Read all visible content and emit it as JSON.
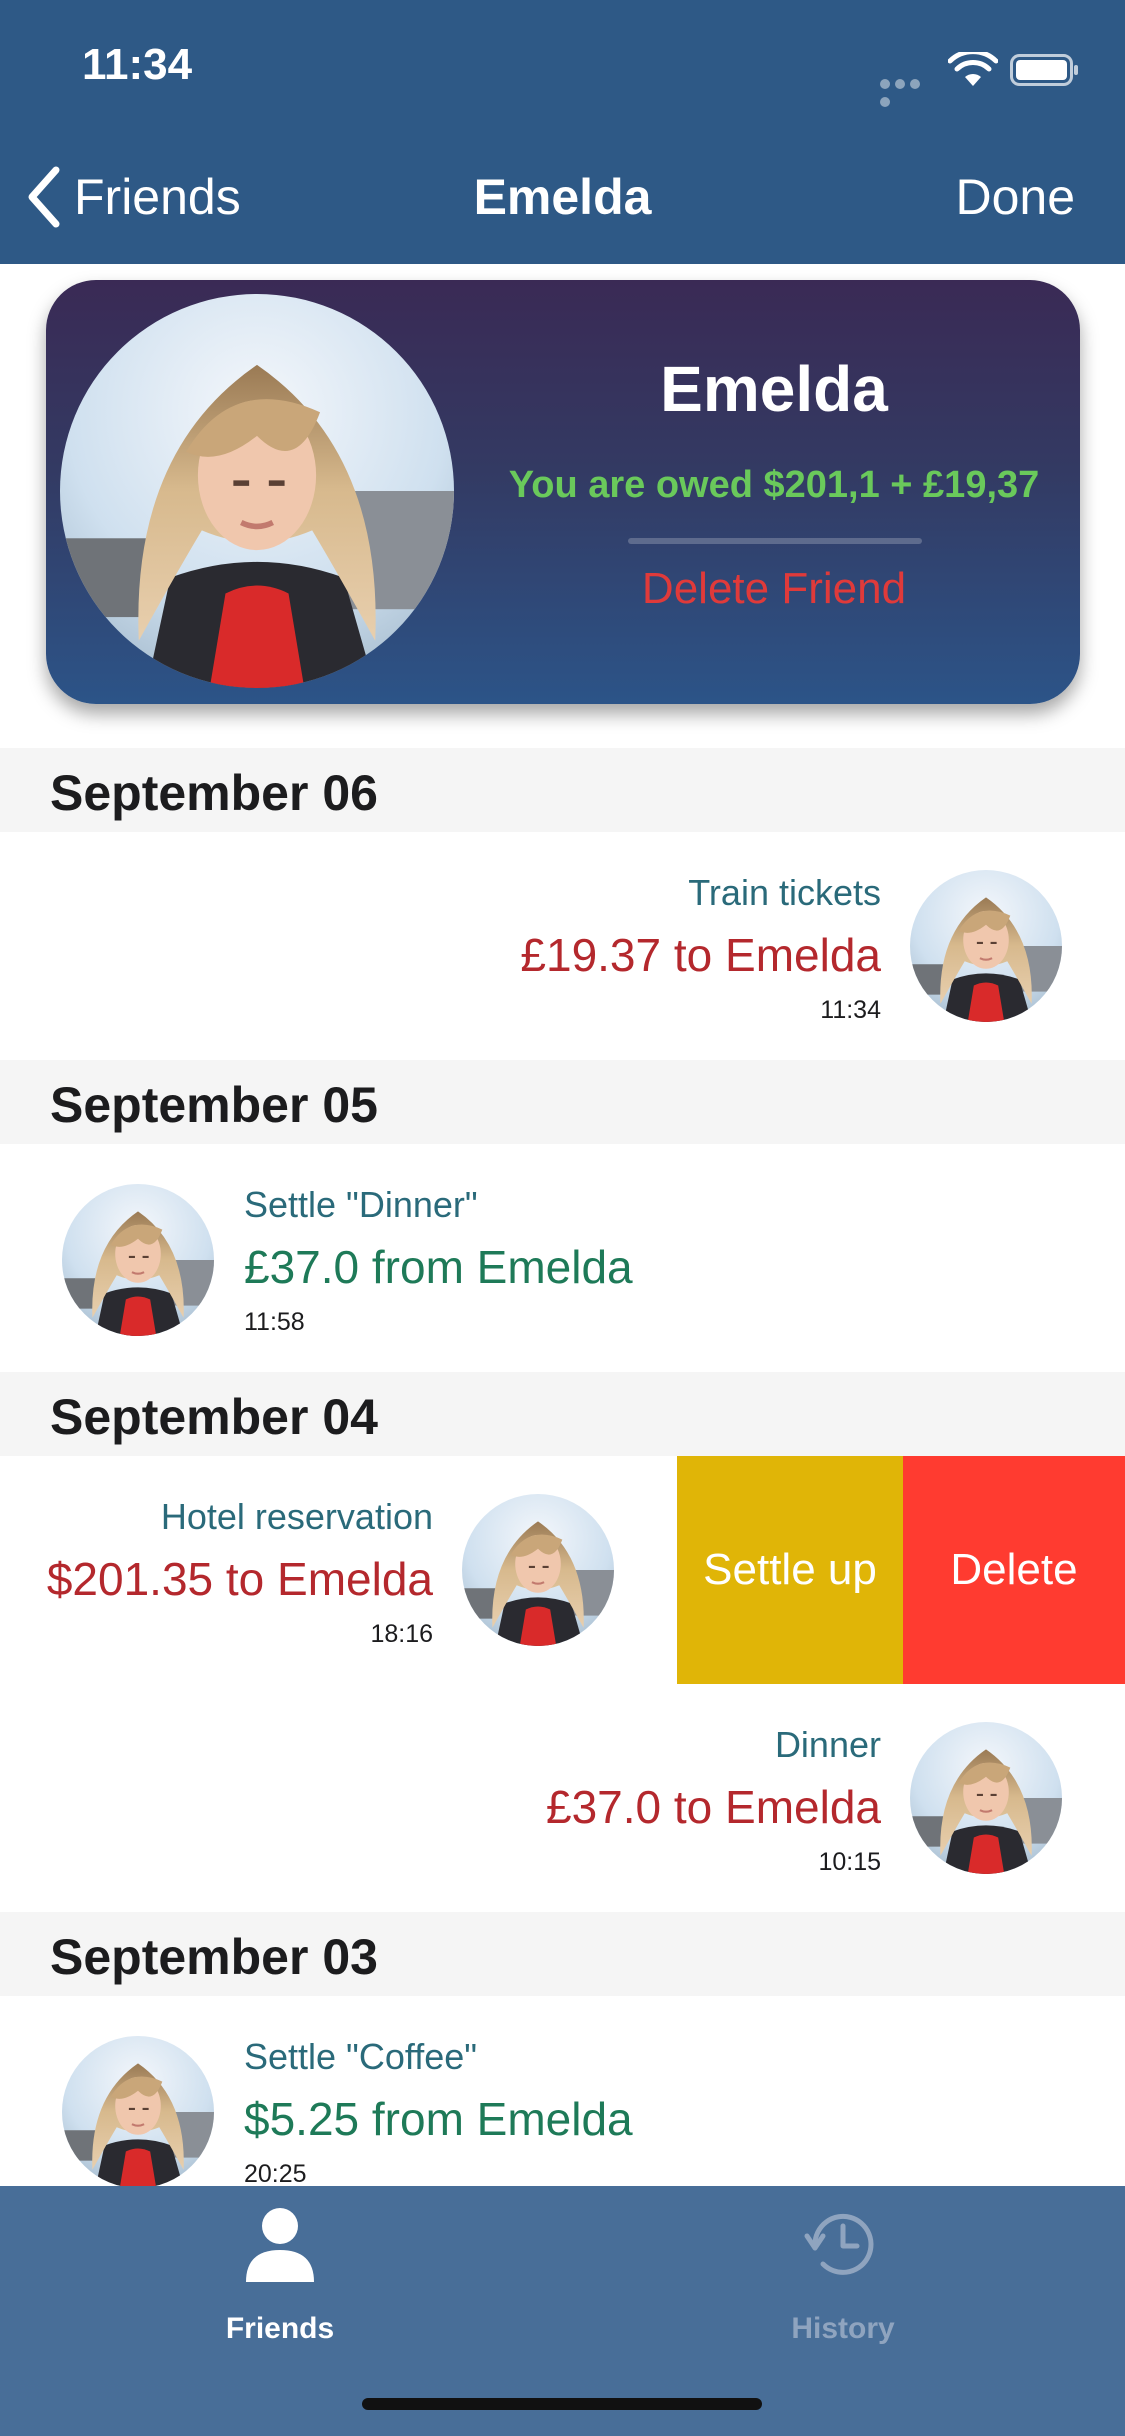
{
  "status_bar": {
    "time": "11:34"
  },
  "nav": {
    "back_label": "Friends",
    "title": "Emelda",
    "done_label": "Done"
  },
  "profile": {
    "name": "Emelda",
    "owed_summary": "You are owed $201,1 + £19,37",
    "delete_label": "Delete Friend"
  },
  "sections": [
    {
      "date": "September 06"
    },
    {
      "date": "September 05"
    },
    {
      "date": "September 04"
    },
    {
      "date": "September 03"
    }
  ],
  "transactions": [
    {
      "description": "Train tickets",
      "amount": "£19.37 to Emelda",
      "time": "11:34",
      "direction": "owe"
    },
    {
      "description": "Settle \"Dinner\"",
      "amount": "£37.0 from Emelda",
      "time": "11:58",
      "direction": "receive"
    },
    {
      "description": "Hotel reservation",
      "amount": "$201.35 to Emelda",
      "time": "18:16",
      "direction": "owe"
    },
    {
      "description": "Dinner",
      "amount": "£37.0 to Emelda",
      "time": "10:15",
      "direction": "owe"
    },
    {
      "description": "Settle \"Coffee\"",
      "amount": "$5.25 from Emelda",
      "time": "20:25",
      "direction": "receive"
    }
  ],
  "swipe_actions": {
    "settle_label": "Settle up",
    "delete_label": "Delete"
  },
  "tabs": [
    {
      "label": "Friends",
      "icon": "person-icon",
      "selected": true
    },
    {
      "label": "History",
      "icon": "clock-history-icon",
      "selected": false
    }
  ],
  "colors": {
    "nav_background": "#2e5986",
    "tab_background": "#486e98",
    "owed_green": "#6ac95b",
    "debt_red": "#b4282d",
    "received_green": "#1e7a58",
    "settle_yellow": "#e0b507",
    "delete_red": "#ff3b30"
  }
}
